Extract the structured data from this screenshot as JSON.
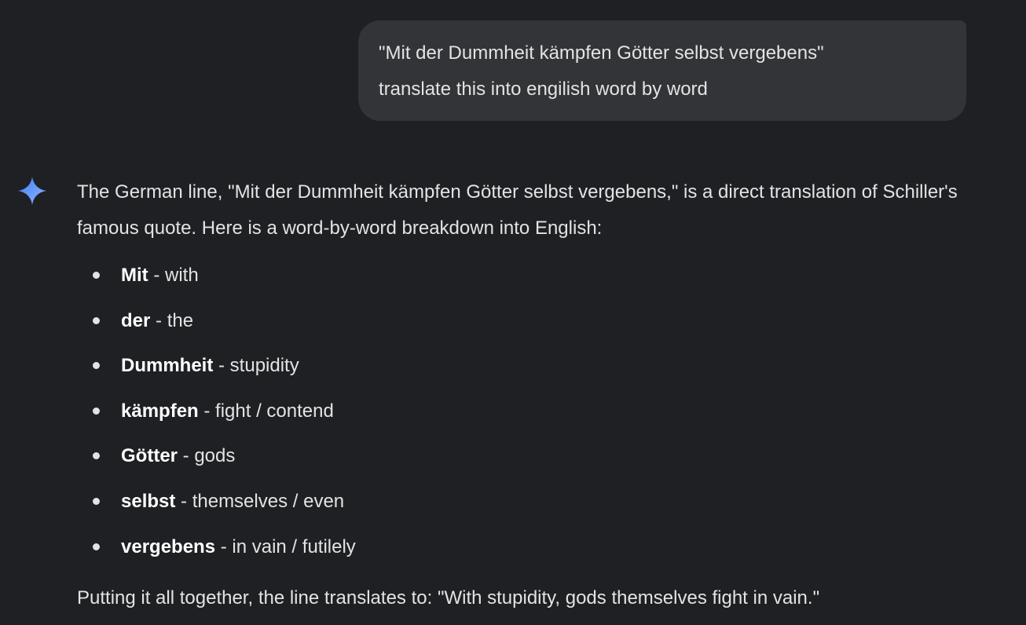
{
  "user_message": {
    "line1": "\"Mit der Dummheit kämpfen Götter selbst vergebens\"",
    "line2": "translate this into engilish word by word"
  },
  "response": {
    "icon": "gemini-sparkle-icon",
    "intro": "The German line, \"Mit der Dummheit kämpfen Götter selbst vergebens,\" is a direct translation of Schiller's famous quote. Here is a word-by-word breakdown into English:",
    "words": [
      {
        "term": "Mit",
        "meaning": " - with"
      },
      {
        "term": "der",
        "meaning": " - the"
      },
      {
        "term": "Dummheit",
        "meaning": " - stupidity"
      },
      {
        "term": "kämpfen",
        "meaning": " - fight / contend"
      },
      {
        "term": "Götter",
        "meaning": " - gods"
      },
      {
        "term": "selbst",
        "meaning": " - themselves / even"
      },
      {
        "term": "vergebens",
        "meaning": " - in vain / futilely"
      }
    ],
    "conclusion": "Putting it all together, the line translates to: \"With stupidity, gods themselves fight in vain.\""
  },
  "colors": {
    "background": "#1f2023",
    "bubble": "#333438",
    "text": "#e3e3e3",
    "sparkle_start": "#4c8df6",
    "sparkle_end": "#7aa7ff"
  }
}
